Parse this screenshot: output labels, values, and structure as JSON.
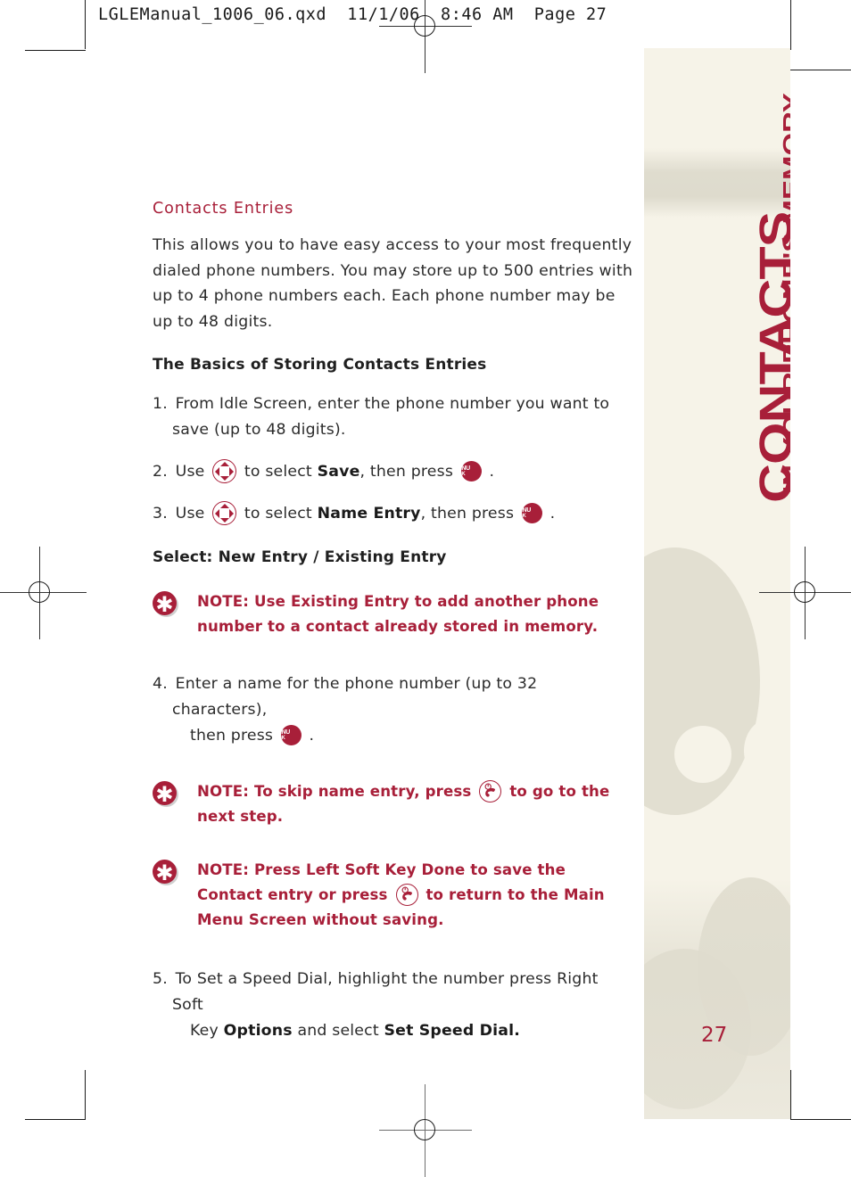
{
  "print_header": "LGLEManual_1006_06.qxd  11/1/06  8:46 AM  Page 27",
  "colors": {
    "accent": "#a81f39",
    "sidebar_bg": "#f6f3e8",
    "body_text": "#2b2b2b"
  },
  "sidebar": {
    "title": "CONTACTS",
    "subtitle": "IN YOUR PHONE'S MEMORY",
    "page_number": "27"
  },
  "content": {
    "section_heading": "Contacts Entries",
    "intro_paragraph": "This allows you to have easy access to your most frequently dialed phone numbers. You may store up to 500 entries with up to 4 phone numbers each. Each phone number may be up to 48 digits.",
    "subheading_basics": "The Basics of Storing Contacts Entries",
    "subheading_select": "Select: New Entry / Existing Entry",
    "steps": {
      "step1": {
        "number": "1.",
        "text": "From Idle Screen, enter the phone number you want to save (up to 48 digits)."
      },
      "step2": {
        "number": "2.",
        "before": "Use",
        "middle": "to select",
        "bold": "Save",
        "after": ", then press",
        "end": "."
      },
      "step3": {
        "number": "3.",
        "before": "Use",
        "middle": "to select",
        "bold": "Name Entry",
        "after": ", then press",
        "end": "."
      },
      "step4": {
        "number": "4.",
        "line1": "Enter a name for the phone number (up to 32 characters),",
        "line2_before": "then press",
        "line2_end": "."
      },
      "step5": {
        "number": "5.",
        "line1": "To Set a Speed Dial, highlight the number  press Right Soft",
        "line2_before": "Key",
        "bold1": "Options",
        "line2_middle": "and select",
        "bold2": "Set Speed Dial."
      }
    },
    "notes": {
      "note1": "NOTE: Use Existing Entry to add another phone number to a contact already stored in memory.",
      "note2_before": "NOTE: To skip name entry, press",
      "note2_after": "to go to the next step.",
      "note3_before": "NOTE: Press Left Soft Key Done to save the Contact entry or press",
      "note3_after": "to return to the Main Menu Screen without saving."
    }
  },
  "icons": {
    "nav_key": "navigation-dpad-icon",
    "menu_ok_key_line1": "MENU",
    "menu_ok_key_line2": "OK",
    "end_key": "end-call-key-icon",
    "note_marker": "asterisk-icon"
  }
}
